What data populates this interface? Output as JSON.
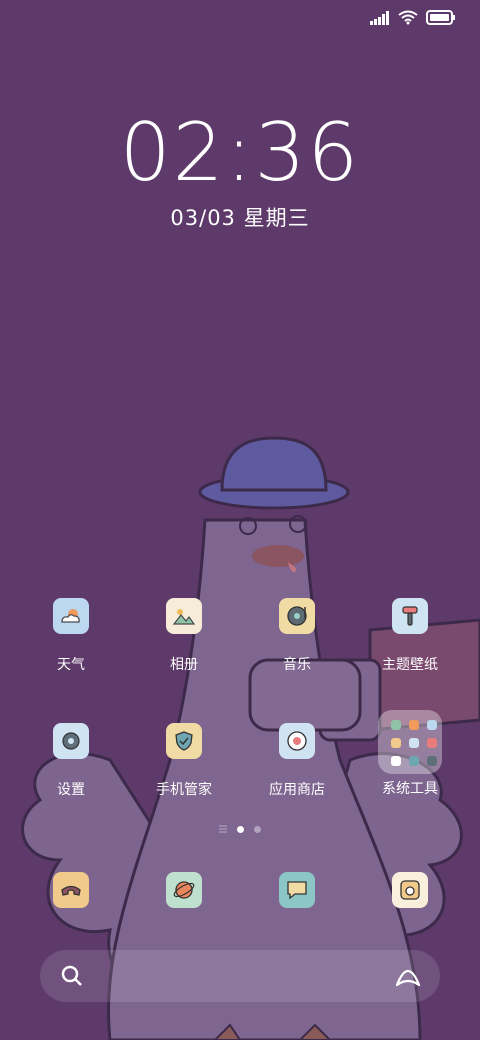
{
  "status_bar": {
    "signal_icon": "signal-icon",
    "wifi_icon": "wifi-icon",
    "battery_icon": "battery-icon"
  },
  "lock": {
    "time": "02:36",
    "date": "03/03 星期三"
  },
  "apps_row1": [
    {
      "label": "天气",
      "icon": "weather-icon",
      "tile_color": "#bcd7f0"
    },
    {
      "label": "相册",
      "icon": "gallery-icon",
      "tile_color": "#f7ecd9"
    },
    {
      "label": "音乐",
      "icon": "music-icon",
      "tile_color": "#f1dba4"
    },
    {
      "label": "主题壁纸",
      "icon": "themes-icon",
      "tile_color": "#cfe4f3"
    }
  ],
  "apps_row2": [
    {
      "label": "设置",
      "icon": "settings-icon",
      "tile_color": "#cfe3f2"
    },
    {
      "label": "手机管家",
      "icon": "security-icon",
      "tile_color": "#f1dba4"
    },
    {
      "label": "应用商店",
      "icon": "app-store-icon",
      "tile_color": "#cfe3f2"
    },
    {
      "label": "系统工具",
      "icon": "folder-icon"
    }
  ],
  "dock": [
    {
      "icon": "phone-icon",
      "tile_color": "#f1c98b"
    },
    {
      "icon": "browser-icon",
      "tile_color": "#bfe0cf"
    },
    {
      "icon": "messages-icon",
      "tile_color": "#8cc6c6"
    },
    {
      "icon": "camera-icon",
      "tile_color": "#f8efdc"
    }
  ],
  "search": {
    "search_icon": "search-icon",
    "assistant_icon": "assistant-icon"
  },
  "pages": {
    "count": 3,
    "current_index": 1
  }
}
